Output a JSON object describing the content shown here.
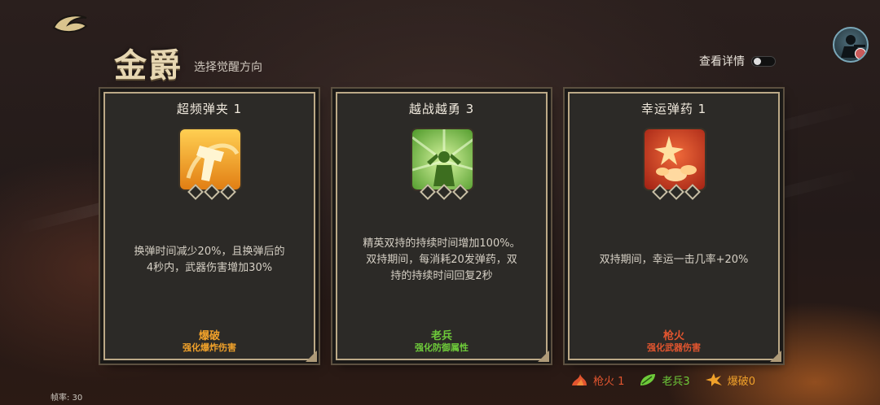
{
  "header": {
    "title": "金爵",
    "subtitle": "选择觉醒方向",
    "detail_label": "查看详情"
  },
  "colors": {
    "orange": "#f0a12a",
    "green": "#6ecb3a",
    "red": "#e2552f",
    "border": "#bca987"
  },
  "cards": [
    {
      "title": "超频弹夹 1",
      "icon": "gun-reload-icon",
      "desc_lines": [
        "换弹时间减少20%，且换弹后的",
        "4秒内，武器伤害增加30%"
      ],
      "type": "爆破",
      "effect": "强化爆炸伤害",
      "color": "#f0a12a",
      "level_filled": 0,
      "level_max": 3
    },
    {
      "title": "越战越勇 3",
      "icon": "dual-wield-icon",
      "desc_lines": [
        "精英双持的持续时间增加100%。",
        "双持期间，每消耗20发弹药，双",
        "持的持续时间回复2秒"
      ],
      "type": "老兵",
      "effect": "强化防御属性",
      "color": "#6ecb3a",
      "level_filled": 0,
      "level_max": 3
    },
    {
      "title": "幸运弹药 1",
      "icon": "lucky-ammo-icon",
      "desc_lines": [
        "双持期间，幸运一击几率+20%"
      ],
      "type": "枪火",
      "effect": "强化武器伤害",
      "color": "#e2552f",
      "level_filled": 0,
      "level_max": 3
    }
  ],
  "resources": [
    {
      "icon": "flame-icon",
      "label": "枪火 1",
      "color": "#e2552f"
    },
    {
      "icon": "leaf-icon",
      "label": "老兵3",
      "color": "#6ecb3a"
    },
    {
      "icon": "burst-icon",
      "label": "爆破0",
      "color": "#f0a12a"
    }
  ],
  "footer": {
    "fps": "帧率: 30"
  }
}
